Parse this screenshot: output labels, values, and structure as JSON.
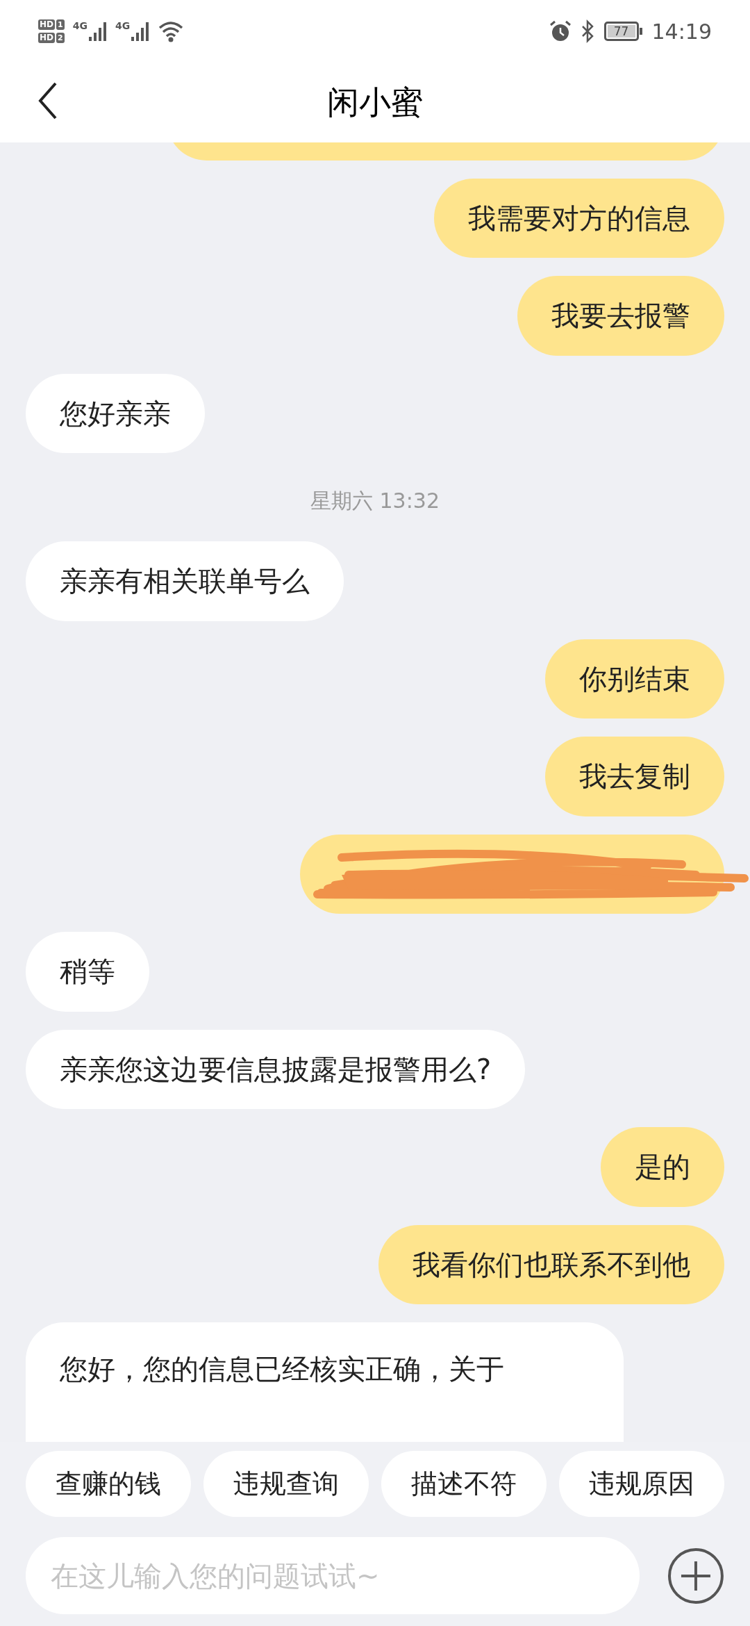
{
  "status_bar": {
    "sims": [
      {
        "hd": "HD",
        "slot": "1"
      },
      {
        "hd": "HD",
        "slot": "2"
      }
    ],
    "networks": [
      "4G",
      "4G"
    ],
    "battery": "77",
    "time": "14:19"
  },
  "header": {
    "title": "闲小蜜"
  },
  "messages": [
    {
      "kind": "partial",
      "outgoing": true
    },
    {
      "kind": "text",
      "outgoing": true,
      "text": "我需要对方的信息"
    },
    {
      "kind": "text",
      "outgoing": true,
      "text": "我要去报警"
    },
    {
      "kind": "text",
      "outgoing": false,
      "text": "您好亲亲"
    },
    {
      "kind": "time",
      "text": "星期六 13:32"
    },
    {
      "kind": "text",
      "outgoing": false,
      "text": "亲亲有相关联单号么"
    },
    {
      "kind": "text",
      "outgoing": true,
      "text": "你别结束"
    },
    {
      "kind": "text",
      "outgoing": true,
      "text": "我去复制"
    },
    {
      "kind": "redacted",
      "outgoing": true
    },
    {
      "kind": "text",
      "outgoing": false,
      "text": "稍等"
    },
    {
      "kind": "text",
      "outgoing": false,
      "text": "亲亲您这边要信息披露是报警用么?"
    },
    {
      "kind": "text",
      "outgoing": true,
      "text": "是的"
    },
    {
      "kind": "text",
      "outgoing": true,
      "text": "我看你们也联系不到他"
    },
    {
      "kind": "cut",
      "outgoing": false,
      "text": "您好，您的信息已经核实正确，关于"
    }
  ],
  "quick_replies": [
    "查赚的钱",
    "违规查询",
    "描述不符",
    "违规原因"
  ],
  "input": {
    "placeholder": "在这儿输入您的问题试试~"
  }
}
